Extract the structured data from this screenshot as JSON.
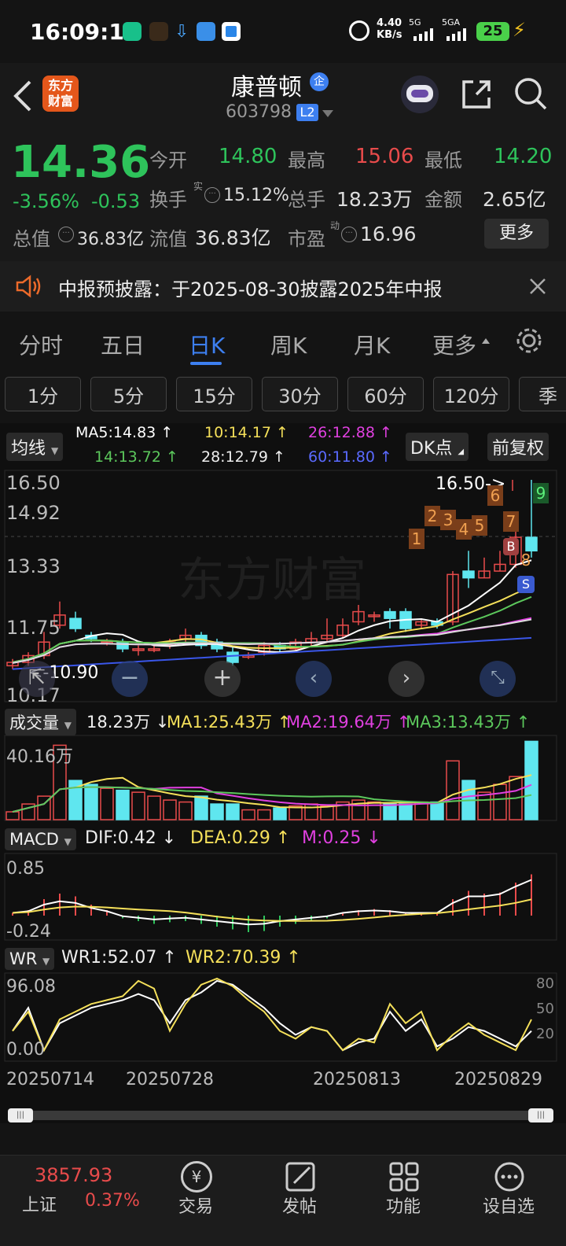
{
  "status_bar": {
    "time": "16:09:12",
    "speed": "4.40",
    "speed_unit": "KB/s",
    "sig1": "5G",
    "sig2": "5GA",
    "battery": "25"
  },
  "header": {
    "logo": "东方财富",
    "title": "康普顿",
    "badge": "企",
    "code": "603798",
    "level": "L2"
  },
  "quote": {
    "price": "14.36",
    "pct": "-3.56%",
    "chg": "-0.53",
    "open_label": "今开",
    "open": "14.80",
    "high_label": "最高",
    "high": "15.06",
    "low_label": "最低",
    "low": "14.20",
    "turnover_label": "换手",
    "turnover_sup": "实",
    "turnover": "15.12%",
    "vol_label": "总手",
    "vol": "18.23万",
    "amt_label": "金额",
    "amt": "2.65亿",
    "mcap_label": "总值",
    "mcap": "36.83亿",
    "float_label": "流值",
    "float": "36.83亿",
    "pe_label": "市盈",
    "pe_sup": "动",
    "pe": "16.96",
    "more": "更多"
  },
  "notice": {
    "text": "中报预披露：于2025-08-30披露2025年中报"
  },
  "tabs": [
    "分时",
    "五日",
    "日K",
    "周K",
    "月K",
    "更多"
  ],
  "active_tab": "日K",
  "period_buttons": [
    "1分",
    "5分",
    "15分",
    "30分",
    "60分",
    "120分",
    "季"
  ],
  "ma_bar": {
    "label": "均线",
    "ma5": "MA5:14.83 ↑",
    "ma10": "10:14.17 ↑",
    "ma26": "26:12.88 ↑",
    "ma14": "14:13.72 ↑",
    "ma28": "28:12.79 ↑",
    "ma60": "60:11.80 ↑",
    "dk": "DK点",
    "adjust": "前复权"
  },
  "kline": {
    "y_labels": [
      "16.50",
      "14.92",
      "13.33",
      "11.75",
      "10.17"
    ],
    "max_annot": "16.50->",
    "min_annot": "<-10.90",
    "watermark": "东方财富",
    "seq": [
      "1",
      "2",
      "3",
      "4",
      "5",
      "6",
      "7",
      "8",
      "9"
    ],
    "b": "B",
    "s": "S"
  },
  "volume": {
    "label": "成交量",
    "v": "18.23万 ↓",
    "ma1": "MA1:25.43万 ↑",
    "ma2": "MA2:19.64万 ↑",
    "ma3": "MA3:13.43万 ↑",
    "y": "40.16万"
  },
  "macd": {
    "label": "MACD",
    "dif": "DIF:0.42 ↓",
    "dea": "DEA:0.29 ↑",
    "m": "M:0.25 ↓",
    "y_top": "0.85",
    "y_bot": "-0.24"
  },
  "wr": {
    "label": "WR",
    "wr1": "WR1:52.07 ↑",
    "wr2": "WR2:70.39 ↑",
    "y_top": "96.08",
    "y_bot": "0.00",
    "r80": "80",
    "r50": "50",
    "r20": "20"
  },
  "dates": [
    "20250714",
    "20250728",
    "20250813",
    "20250829"
  ],
  "bottom_nav": {
    "index_value": "3857.93",
    "index_name": "上证",
    "index_pct": "0.37%",
    "items": [
      "交易",
      "发帖",
      "功能",
      "设自选"
    ]
  },
  "colors": {
    "up": "#e84b4b",
    "down": "#2ec35b",
    "cyan": "#5fe6ef",
    "accent": "#3d7ff0",
    "orange": "#ec6a2a"
  },
  "chart_data": [
    {
      "type": "candlestick",
      "title": "",
      "ylim": [
        10.17,
        16.5
      ],
      "series": [
        {
          "name": "MA5",
          "values": [
            14.83
          ]
        },
        {
          "name": "10",
          "values": [
            14.17
          ]
        },
        {
          "name": "26",
          "values": [
            12.88
          ]
        },
        {
          "name": "14",
          "values": [
            13.72
          ]
        },
        {
          "name": "28",
          "values": [
            12.79
          ]
        },
        {
          "name": "60",
          "values": [
            11.8
          ]
        }
      ]
    },
    {
      "type": "bar",
      "title": "",
      "ylim": [
        0,
        40.16
      ],
      "series": [
        {
          "name": "MA1",
          "values": [
            25.43
          ]
        },
        {
          "name": "MA2",
          "values": [
            19.64
          ]
        },
        {
          "name": "MA3",
          "values": [
            13.43
          ]
        }
      ]
    },
    {
      "type": "line",
      "title": "",
      "ylim": [
        -0.24,
        0.85
      ],
      "series": [
        {
          "name": "DIF",
          "values": [
            0.42
          ]
        },
        {
          "name": "DEA",
          "values": [
            0.29
          ]
        },
        {
          "name": "M",
          "values": [
            0.25
          ]
        }
      ]
    },
    {
      "type": "line",
      "title": "",
      "ylim": [
        0,
        96.08
      ],
      "series": [
        {
          "name": "WR1",
          "values": [
            52.07
          ]
        },
        {
          "name": "WR2",
          "values": [
            70.39
          ]
        }
      ]
    }
  ]
}
